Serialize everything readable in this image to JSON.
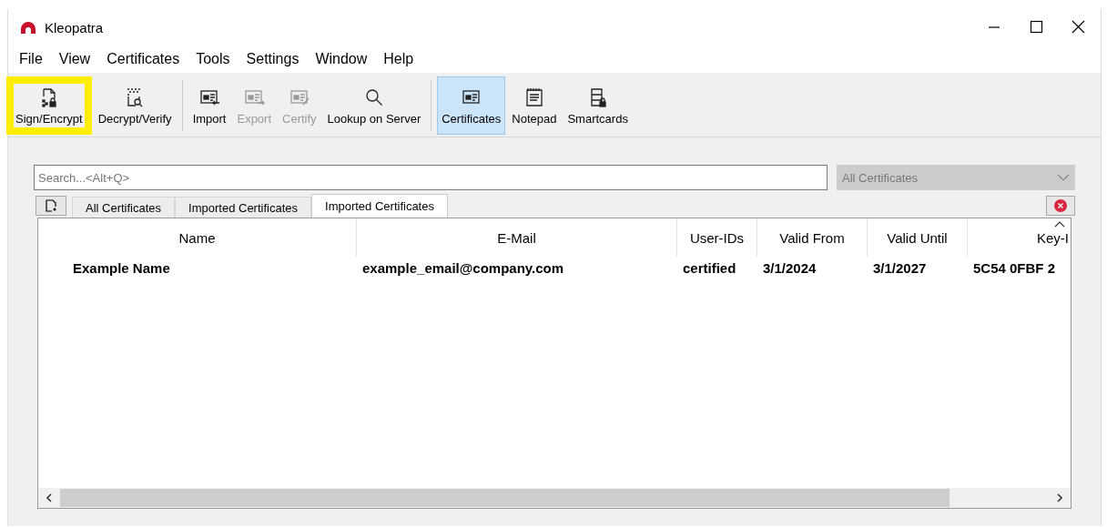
{
  "window": {
    "title": "Kleopatra"
  },
  "menu": [
    "File",
    "View",
    "Certificates",
    "Tools",
    "Settings",
    "Window",
    "Help"
  ],
  "toolbar": [
    {
      "kind": "button",
      "label": "Sign/Encrypt",
      "disabled": false,
      "selected": false,
      "highlighted": true
    },
    {
      "kind": "button",
      "label": "Decrypt/Verify",
      "disabled": false,
      "selected": false,
      "highlighted": false
    },
    {
      "kind": "separator"
    },
    {
      "kind": "button",
      "label": "Import",
      "disabled": false,
      "selected": false,
      "highlighted": false
    },
    {
      "kind": "button",
      "label": "Export",
      "disabled": true,
      "selected": false,
      "highlighted": false
    },
    {
      "kind": "button",
      "label": "Certify",
      "disabled": true,
      "selected": false,
      "highlighted": false
    },
    {
      "kind": "button",
      "label": "Lookup on Server",
      "disabled": false,
      "selected": false,
      "highlighted": false
    },
    {
      "kind": "separator"
    },
    {
      "kind": "button",
      "label": "Certificates",
      "disabled": false,
      "selected": true,
      "highlighted": false
    },
    {
      "kind": "button",
      "label": "Notepad",
      "disabled": false,
      "selected": false,
      "highlighted": false
    },
    {
      "kind": "button",
      "label": "Smartcards",
      "disabled": false,
      "selected": false,
      "highlighted": false
    }
  ],
  "search": {
    "placeholder": "Search...<Alt+Q>"
  },
  "filter": {
    "value": "All Certificates",
    "disabled": true
  },
  "tabs": [
    {
      "label": "All Certificates",
      "selected": false
    },
    {
      "label": "Imported Certificates",
      "selected": false
    },
    {
      "label": "Imported Certificates",
      "selected": true
    }
  ],
  "table": {
    "columns": [
      "Name",
      "E-Mail",
      "User-IDs",
      "Valid From",
      "Valid Until",
      "Key-I"
    ],
    "rows": [
      [
        "Example Name",
        "example_email@company.com",
        "certified",
        "3/1/2024",
        "3/1/2027",
        "5C54 0FBF 2"
      ]
    ]
  }
}
